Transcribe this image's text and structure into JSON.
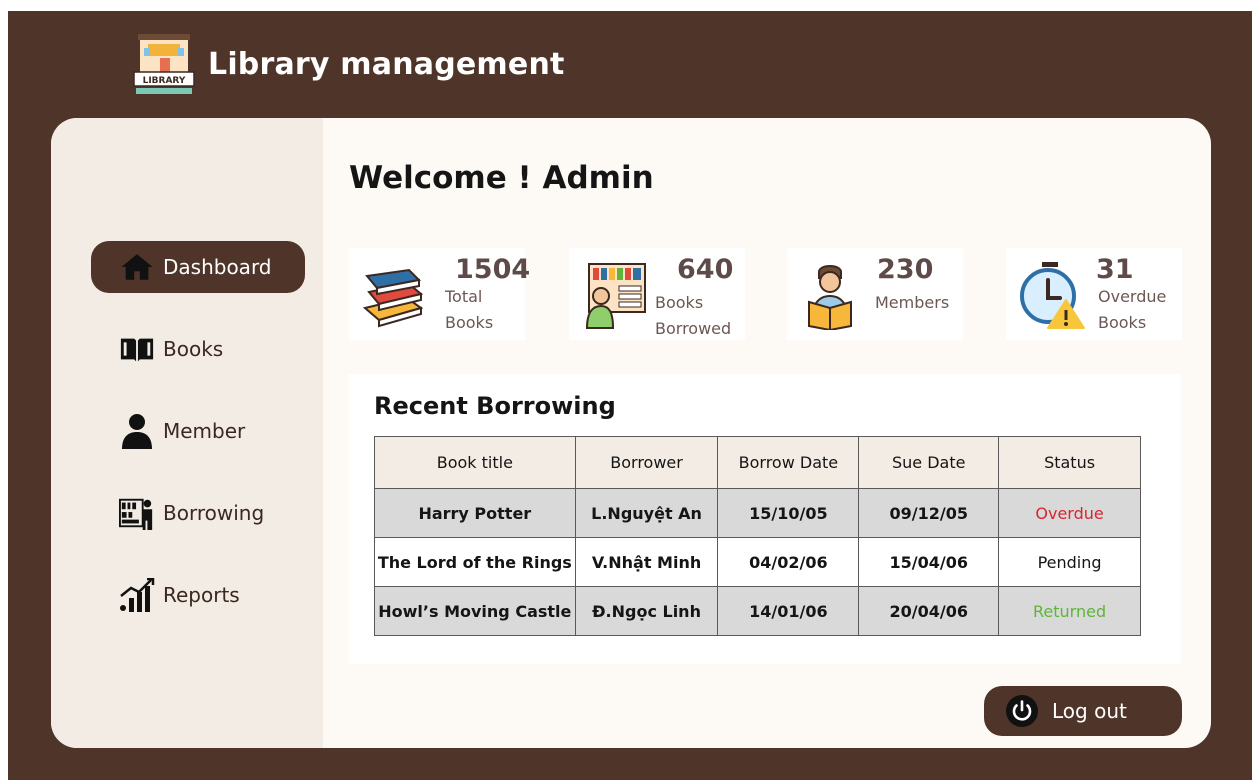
{
  "app": {
    "title": "Library management",
    "logo_text": "LIBRARY"
  },
  "sidebar": {
    "items": [
      {
        "label": "Dashboard",
        "icon": "home-icon",
        "active": true
      },
      {
        "label": "Books",
        "icon": "book-icon"
      },
      {
        "label": "Member",
        "icon": "user-icon"
      },
      {
        "label": "Borrowing",
        "icon": "borrowing-icon"
      },
      {
        "label": "Reports",
        "icon": "chart-icon"
      }
    ]
  },
  "main": {
    "welcome": "Welcome ! Admin",
    "stats": [
      {
        "value": "1504",
        "label_line1": "Total",
        "label_line2": "Books",
        "icon": "books-stack-icon"
      },
      {
        "value": "640",
        "label_line1": "Books",
        "label_line2": "Borrowed",
        "icon": "bookshelf-icon"
      },
      {
        "value": "230",
        "label_line1": "Members",
        "label_line2": "",
        "icon": "reader-icon"
      },
      {
        "value": "31",
        "label_line1": "Overdue",
        "label_line2": "Books",
        "icon": "overdue-clock-icon"
      }
    ],
    "recent": {
      "title": "Recent Borrowing",
      "columns": [
        "Book title",
        "Borrower",
        "Borrow Date",
        "Sue Date",
        "Status"
      ],
      "rows": [
        {
          "title": "Harry Potter",
          "borrower": "L.Nguyệt An",
          "borrow_date": "15/10/05",
          "due_date": "09/12/05",
          "status": "Overdue"
        },
        {
          "title": "The Lord of the Rings",
          "borrower": "V.Nhật Minh",
          "borrow_date": "04/02/06",
          "due_date": "15/04/06",
          "status": "Pending"
        },
        {
          "title": "Howl’s Moving Castle",
          "borrower": "Đ.Ngọc Linh",
          "borrow_date": "14/01/06",
          "due_date": "20/04/06",
          "status": "Returned"
        }
      ]
    }
  },
  "logout": {
    "label": "Log out"
  },
  "colors": {
    "brown": "#4f3429",
    "overdue": "#d7262f",
    "returned": "#5fb43a",
    "pending": "#151515"
  }
}
